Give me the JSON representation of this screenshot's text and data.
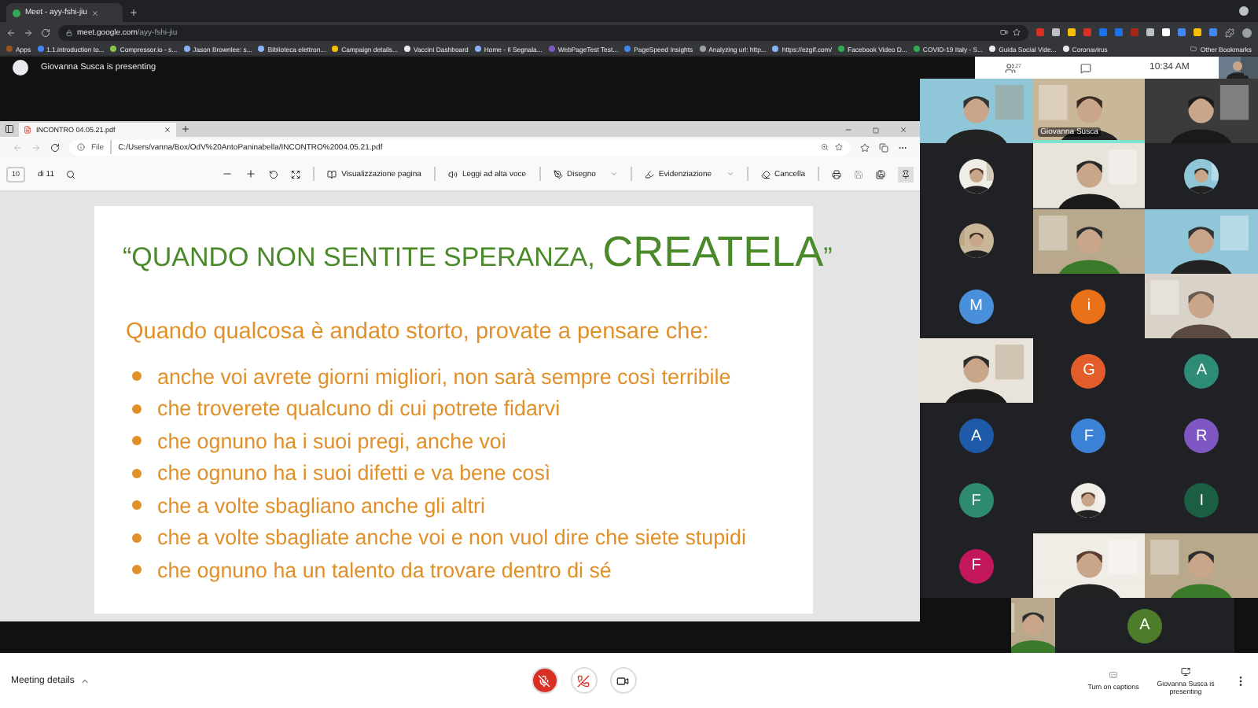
{
  "browser": {
    "tab": {
      "title": "Meet - ayy-fshi-jiu"
    },
    "url": {
      "host": "meet.google.com",
      "path": "/ayy-fshi-jiu"
    },
    "bookmarks": [
      "Apps",
      "1.1.introduction to...",
      "Compressor.io - s...",
      "Jason Brownlee: s...",
      "Biblioteca elettron...",
      "Campaign details...",
      "Vaccini Dashboard",
      "Home - Il Segnala...",
      "WebPageTest Test...",
      "PageSpeed Insights",
      "Analyzing url: http...",
      "https://ezgif.com/",
      "Facebook Video D...",
      "COVID-19 Italy - S...",
      "Guida Social Vide...",
      "Coronavirus"
    ],
    "other_bookmarks": "Other Bookmarks"
  },
  "meet": {
    "presenting_banner": "Giovanna Susca is presenting",
    "participant_count": "27",
    "time": "10:34 AM",
    "tiles": [
      {
        "kind": "video",
        "speaking": false
      },
      {
        "kind": "video",
        "speaking": true,
        "name": "Giovanna Susca"
      },
      {
        "kind": "video",
        "speaking": false
      },
      {
        "kind": "photo-avatar"
      },
      {
        "kind": "video",
        "speaking": false
      },
      {
        "kind": "photo-avatar"
      },
      {
        "kind": "photo-avatar"
      },
      {
        "kind": "video",
        "speaking": false
      },
      {
        "kind": "video",
        "speaking": false
      },
      {
        "kind": "initial",
        "letter": "M",
        "color": "#4a8fd9"
      },
      {
        "kind": "initial",
        "letter": "i",
        "color": "#e8711a"
      },
      {
        "kind": "video",
        "speaking": false
      },
      {
        "kind": "video",
        "speaking": false
      },
      {
        "kind": "initial",
        "letter": "G",
        "color": "#e35d2b"
      },
      {
        "kind": "initial",
        "letter": "A",
        "color": "#2e8b75"
      },
      {
        "kind": "initial",
        "letter": "A",
        "color": "#1e5aa8"
      },
      {
        "kind": "initial",
        "letter": "F",
        "color": "#3b82d6"
      },
      {
        "kind": "initial",
        "letter": "R",
        "color": "#7e57c2"
      },
      {
        "kind": "initial",
        "letter": "F",
        "color": "#2e8b6f"
      },
      {
        "kind": "photo-avatar"
      },
      {
        "kind": "initial",
        "letter": "I",
        "color": "#1b5e43"
      },
      {
        "kind": "initial",
        "letter": "F",
        "color": "#c2185b"
      },
      {
        "kind": "video",
        "speaking": false
      },
      {
        "kind": "video",
        "speaking": false
      }
    ],
    "last_row": [
      {
        "kind": "video",
        "speaking": false
      },
      {
        "kind": "initial",
        "letter": "A",
        "color": "#4d7c2a"
      }
    ]
  },
  "pdf": {
    "tab_title": "INCONTRO 04.05.21.pdf",
    "scheme": "File",
    "path": "C:/Users/vanna/Box/OdV%20AntoPaninabella/INCONTRO%2004.05.21.pdf",
    "page": "10",
    "page_total": "di 11",
    "tools": [
      {
        "label": "Visualizzazione pagina",
        "kind": "view",
        "dropdown": false
      },
      {
        "label": "Leggi ad alta voce",
        "kind": "read",
        "dropdown": false
      },
      {
        "label": "Disegno",
        "kind": "draw",
        "dropdown": true
      },
      {
        "label": "Evidenziazione",
        "kind": "highlight",
        "dropdown": true
      },
      {
        "label": "Cancella",
        "kind": "erase",
        "dropdown": false
      }
    ]
  },
  "slide": {
    "title_start": "“QUANDO NON SENTITE SPERANZA, ",
    "title_emphasis": "CREATELA",
    "title_end": "”",
    "intro": "Quando qualcosa è andato storto, provate a pensare che:",
    "bullets": [
      "anche voi avrete giorni migliori, non sarà sempre così terribile",
      "che troverete qualcuno di cui potrete fidarvi",
      "che ognuno ha i suoi pregi, anche voi",
      "che ognuno ha i suoi difetti e va bene così",
      "che a volte sbagliano anche gli altri",
      "che a volte sbagliate anche voi e non vuol dire che siete stupidi",
      "che ognuno ha un talento da trovare dentro di sé"
    ]
  },
  "controls": {
    "meeting_details": "Meeting details",
    "mic_muted": true,
    "captions": "Turn on captions",
    "presenting": "Giovanna Susca is presenting"
  }
}
